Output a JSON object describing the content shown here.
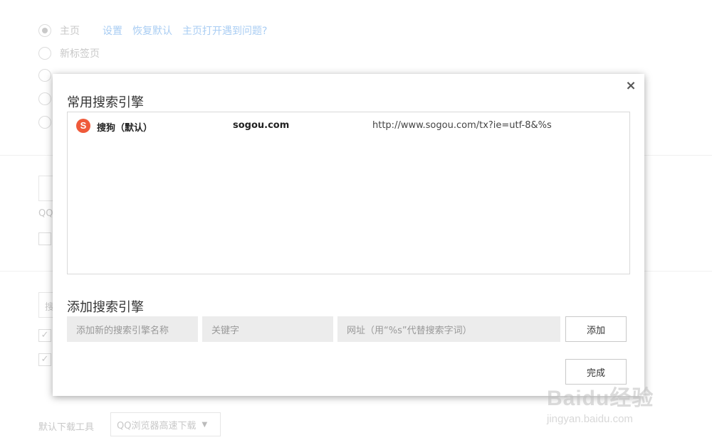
{
  "background": {
    "startup_options": [
      "主页",
      "新标签页"
    ],
    "links": [
      "设置",
      "恢复默认",
      "主页打开遇到问题?"
    ],
    "download_tool_label": "默认下载工具",
    "download_tool_value": "QQ浏览器高速下载",
    "partial_texts": [
      "QQ",
      "搜"
    ]
  },
  "dialog": {
    "close_label": "×",
    "common_title": "常用搜索引擎",
    "engines": [
      {
        "icon": "S",
        "name": "搜狗（默认）",
        "keyword": "sogou.com",
        "url": "http://www.sogou.com/tx?ie=utf-8&%s"
      }
    ],
    "add_title": "添加搜索引擎",
    "name_placeholder": "添加新的搜索引擎名称",
    "keyword_placeholder": "关键字",
    "url_placeholder": "网址（用“%s”代替搜索字词）",
    "add_button": "添加",
    "done_button": "完成"
  },
  "watermark": {
    "logo_text": "Baidu经验",
    "site": "jingyan.baidu.com"
  },
  "colors": {
    "sogou_icon": "#ef5a3a",
    "link_blue": "#a9cdf3",
    "input_bg": "#ececec"
  }
}
